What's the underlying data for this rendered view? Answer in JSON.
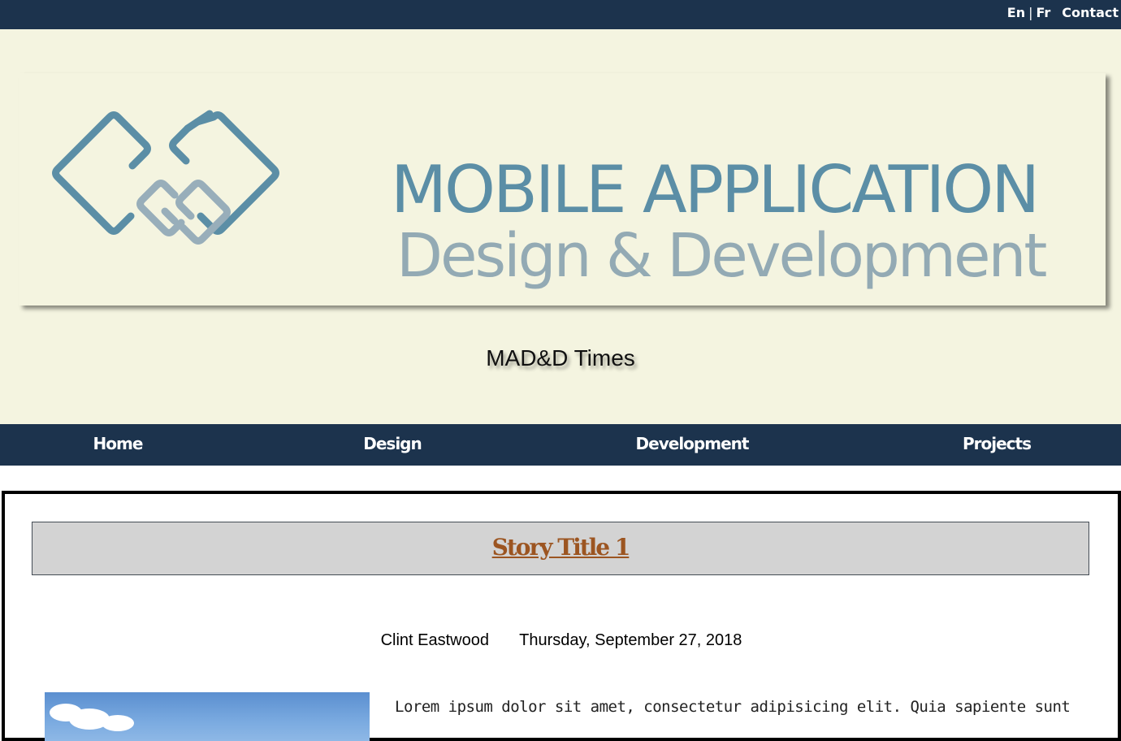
{
  "topbar": {
    "lang_en": "En",
    "lang_separator": "|",
    "lang_fr": "Fr",
    "contact": "Contact"
  },
  "header": {
    "brand_line1": "MOBILE APPLICATION",
    "brand_line2": "Design & Development",
    "site_title": "MAD&D Times",
    "logo_icon": "interlocking-diamonds-logo"
  },
  "nav": {
    "items": [
      {
        "label": "Home"
      },
      {
        "label": "Design"
      },
      {
        "label": "Development"
      },
      {
        "label": "Projects"
      }
    ]
  },
  "story": {
    "title": "Story Title 1",
    "author": "Clint Eastwood",
    "date": "Thursday, September 27, 2018",
    "text": "Lorem ipsum dolor sit amet, consectetur adipisicing elit. Quia sapiente sunt modi tempore eius"
  },
  "colors": {
    "navy": "#1c334d",
    "cream": "#f4f4e0",
    "brand_blue": "#5b8ea6",
    "brand_grey": "#93aab4",
    "story_title": "#9c5521",
    "story_box": "#d3d3d3"
  }
}
